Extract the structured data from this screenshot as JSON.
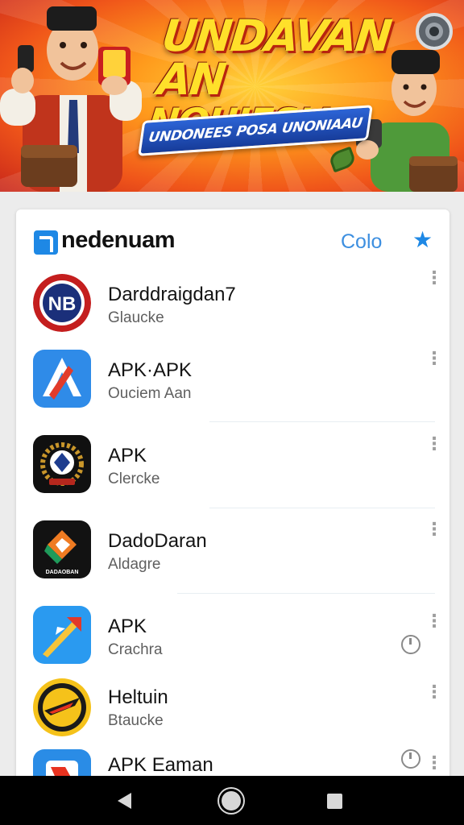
{
  "banner": {
    "title_line1": "UNDAVAN AN",
    "title_line2": "NOUIESIA",
    "ribbon": "UNDONEES POSA UNONIAAU"
  },
  "header": {
    "brand": "nedenuam",
    "link": "Colo"
  },
  "apps": [
    {
      "title": "Darddraigdan7",
      "subtitle": "Glaucke",
      "trailing": ""
    },
    {
      "title": "APK·APK",
      "subtitle": "Ouciem Aan",
      "trailing": ""
    },
    {
      "title": "APK",
      "subtitle": "Clercke",
      "trailing": ""
    },
    {
      "title": "DadoDaran",
      "subtitle": "Aldagre",
      "trailing": ""
    },
    {
      "title": "APK",
      "subtitle": "Crachra",
      "trailing": "clock"
    },
    {
      "title": "Heltuin",
      "subtitle": "Btaucke",
      "trailing": ""
    },
    {
      "title": "APK Eaman",
      "subtitle": "",
      "trailing": "clock"
    }
  ],
  "icon_labels": {
    "nb": "NB",
    "dada": "DADAOBAN"
  },
  "colors": {
    "accent": "#1e88e5",
    "link": "#3d8fe0"
  }
}
